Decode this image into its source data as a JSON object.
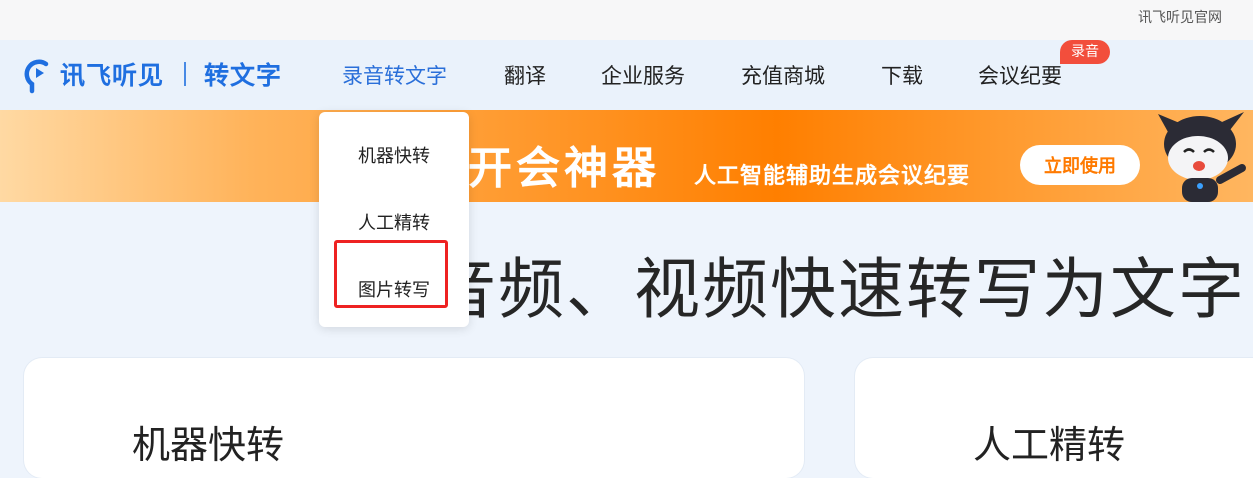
{
  "topbar": {
    "official_site_link": "讯飞听见官网"
  },
  "nav": {
    "brand": "讯飞听见",
    "product": "转文字",
    "items": [
      {
        "label": "录音转文字",
        "active": true
      },
      {
        "label": "翻译"
      },
      {
        "label": "企业服务"
      },
      {
        "label": "充值商城"
      },
      {
        "label": "下载"
      },
      {
        "label": "会议纪要"
      }
    ],
    "badge": "录音"
  },
  "banner": {
    "title": "开会神器",
    "subtitle": "人工智能辅助生成会议纪要",
    "cta": "立即使用"
  },
  "hero": {
    "title": "音频、视频快速转写为文字"
  },
  "dropdown": {
    "items": [
      {
        "label": "机器快转"
      },
      {
        "label": "人工精转"
      },
      {
        "label": "图片转写",
        "highlighted": true
      }
    ]
  },
  "cards": [
    {
      "title": "机器快转"
    },
    {
      "title": "人工精转"
    }
  ],
  "colors": {
    "brand_blue": "#1f6fe0",
    "badge_red": "#f24e3c",
    "banner_orange": "#ff8a00",
    "highlight_red": "#ee2222"
  }
}
